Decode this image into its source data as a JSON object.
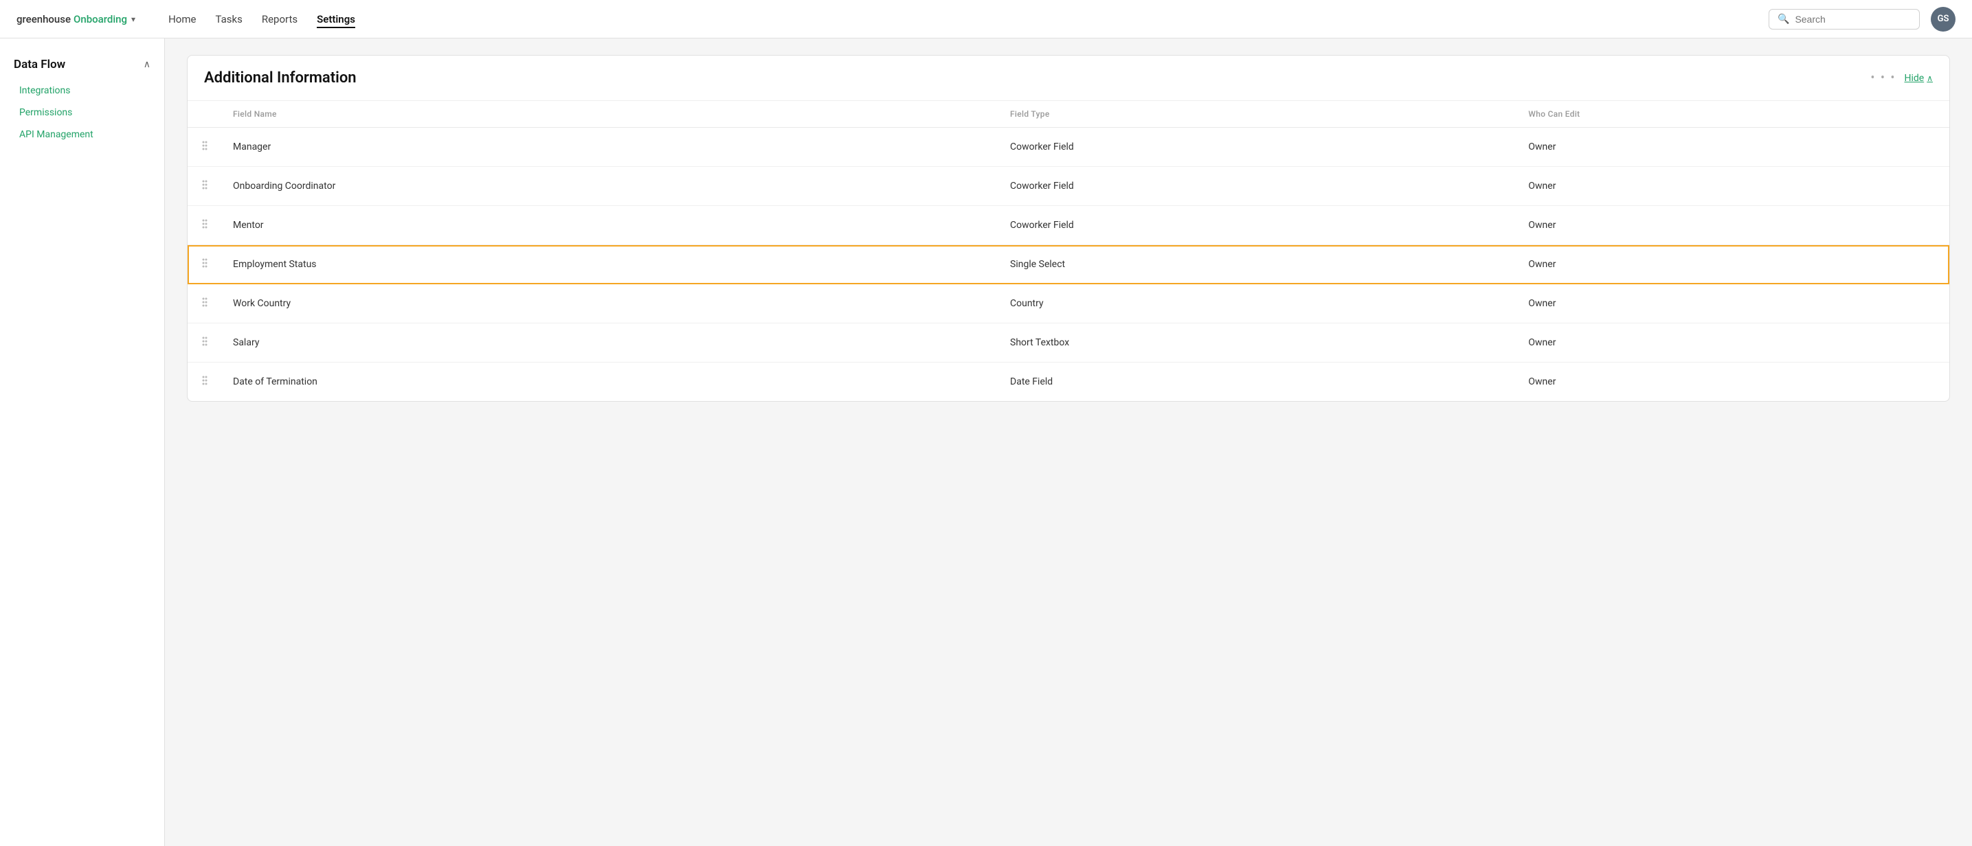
{
  "nav": {
    "logo_greenhouse": "greenhouse",
    "logo_onboarding": "Onboarding",
    "items": [
      {
        "label": "Home",
        "active": false
      },
      {
        "label": "Tasks",
        "active": false
      },
      {
        "label": "Reports",
        "active": false
      },
      {
        "label": "Settings",
        "active": true
      }
    ],
    "search_placeholder": "Search",
    "avatar_initials": "GS"
  },
  "sidebar": {
    "section_title": "Data Flow",
    "items": [
      {
        "label": "Integrations"
      },
      {
        "label": "Permissions"
      },
      {
        "label": "API Management"
      }
    ]
  },
  "main": {
    "card_title": "Additional Information",
    "hide_label": "Hide",
    "table": {
      "columns": [
        "Field Name",
        "Field Type",
        "Who Can Edit"
      ],
      "rows": [
        {
          "field_name": "Manager",
          "field_type": "Coworker Field",
          "who_can_edit": "Owner",
          "highlighted": false
        },
        {
          "field_name": "Onboarding Coordinator",
          "field_type": "Coworker Field",
          "who_can_edit": "Owner",
          "highlighted": false
        },
        {
          "field_name": "Mentor",
          "field_type": "Coworker Field",
          "who_can_edit": "Owner",
          "highlighted": false
        },
        {
          "field_name": "Employment Status",
          "field_type": "Single Select",
          "who_can_edit": "Owner",
          "highlighted": true
        },
        {
          "field_name": "Work Country",
          "field_type": "Country",
          "who_can_edit": "Owner",
          "highlighted": false
        },
        {
          "field_name": "Salary",
          "field_type": "Short Textbox",
          "who_can_edit": "Owner",
          "highlighted": false
        },
        {
          "field_name": "Date of Termination",
          "field_type": "Date Field",
          "who_can_edit": "Owner",
          "highlighted": false
        }
      ]
    }
  },
  "colors": {
    "green": "#24a369",
    "highlight_border": "#f5a623",
    "avatar_bg": "#5b6b7c"
  }
}
